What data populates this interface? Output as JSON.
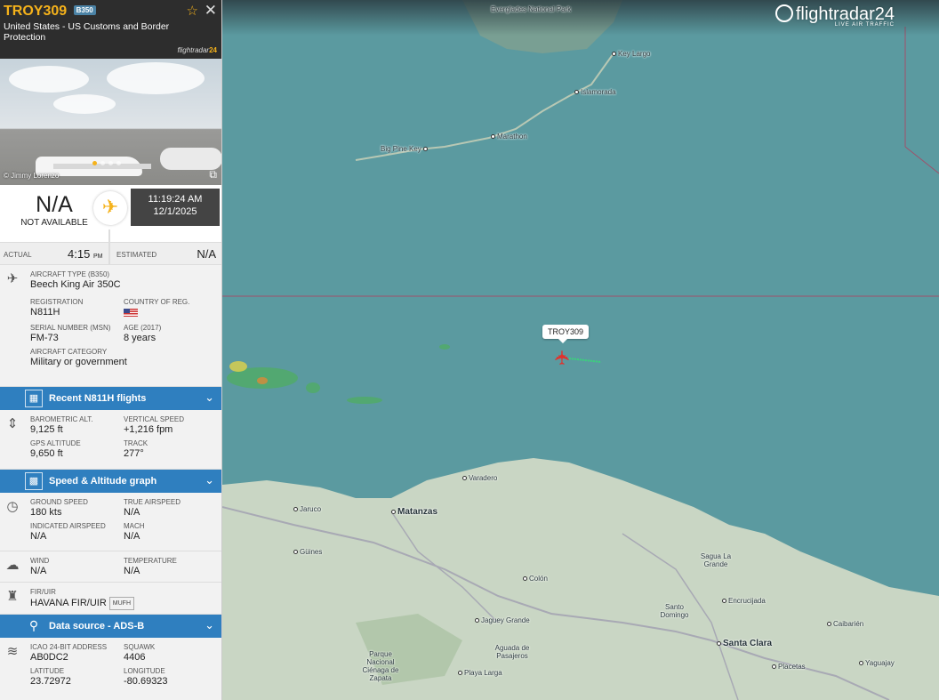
{
  "flight": {
    "callsign": "TROY309",
    "type_badge": "B350",
    "airline": "United States - US Customs and Border Protection",
    "logo_text": "flightradar",
    "logo_suffix": "24",
    "photo_credit": "© Jimmy Lorenzo"
  },
  "route": {
    "origin_code": "N/A",
    "origin_name": "NOT AVAILABLE",
    "time": "11:19:24 AM",
    "date": "12/1/2025"
  },
  "times": {
    "actual_label": "ACTUAL",
    "actual_value": "4:15",
    "actual_suffix": "PM",
    "estimated_label": "ESTIMATED",
    "estimated_value": "N/A"
  },
  "aircraft": {
    "type_label": "AIRCRAFT TYPE (B350)",
    "type_value": "Beech King Air 350C",
    "reg_label": "REGISTRATION",
    "reg_value": "N811H",
    "country_label": "COUNTRY OF REG.",
    "serial_label": "SERIAL NUMBER (MSN)",
    "serial_value": "FM-73",
    "age_label": "AGE (2017)",
    "age_value": "8 years",
    "category_label": "AIRCRAFT CATEGORY",
    "category_value": "Military or government"
  },
  "bars": {
    "recent": "Recent N811H flights",
    "graph": "Speed & Altitude graph",
    "source": "Data source - ADS-B"
  },
  "altitude": {
    "baro_label": "BAROMETRIC ALT.",
    "baro_value": "9,125 ft",
    "vs_label": "VERTICAL SPEED",
    "vs_value": "+1,216 fpm",
    "gps_label": "GPS ALTITUDE",
    "gps_value": "9,650 ft",
    "track_label": "TRACK",
    "track_value": "277°"
  },
  "speed": {
    "gs_label": "GROUND SPEED",
    "gs_value": "180 kts",
    "tas_label": "TRUE AIRSPEED",
    "tas_value": "N/A",
    "ias_label": "INDICATED AIRSPEED",
    "ias_value": "N/A",
    "mach_label": "MACH",
    "mach_value": "N/A"
  },
  "weather": {
    "wind_label": "WIND",
    "wind_value": "N/A",
    "temp_label": "TEMPERATURE",
    "temp_value": "N/A"
  },
  "fir": {
    "label": "FIR/UIR",
    "value": "HAVANA FIR/UIR",
    "code": "MUFH"
  },
  "adsb": {
    "icao_label": "ICAO 24-BIT ADDRESS",
    "icao_value": "AB0DC2",
    "squawk_label": "SQUAWK",
    "squawk_value": "4406",
    "lat_label": "LATITUDE",
    "lat_value": "23.72972",
    "lon_label": "LONGITUDE",
    "lon_value": "-80.69323"
  },
  "map": {
    "brand": "flightradar24",
    "brand_sub": "LIVE AIR TRAFFIC",
    "callout": "TROY309",
    "labels": {
      "park": "Everglades National Park",
      "key_largo": "Key Largo",
      "islamorada": "Islamorada",
      "marathon": "Marathon",
      "big_pine": "Big Pine Key",
      "varadero": "Varadero",
      "jaruco": "Jaruco",
      "matanzas": "Matanzas",
      "guines": "Güines",
      "colon": "Colón",
      "sagua": "Sagua La Grande",
      "encrucijada": "Encrucijada",
      "santo_domingo": "Santo Domingo",
      "santa_clara": "Santa Clara",
      "caibarien": "Caibarién",
      "jaguey": "Jaguey Grande",
      "aguada": "Aguada de Pasajeros",
      "cienaga": "Parque Nacional Ciénaga de Zapata",
      "playa_larga": "Playa Larga",
      "placetas": "Placetas",
      "yaguajay": "Yaguajay"
    },
    "colors": {
      "sea": "#5b9aa0",
      "land": "#c9d6c4",
      "brand_accent": "#f5b21b",
      "bar_blue": "#2f7fbf"
    }
  }
}
